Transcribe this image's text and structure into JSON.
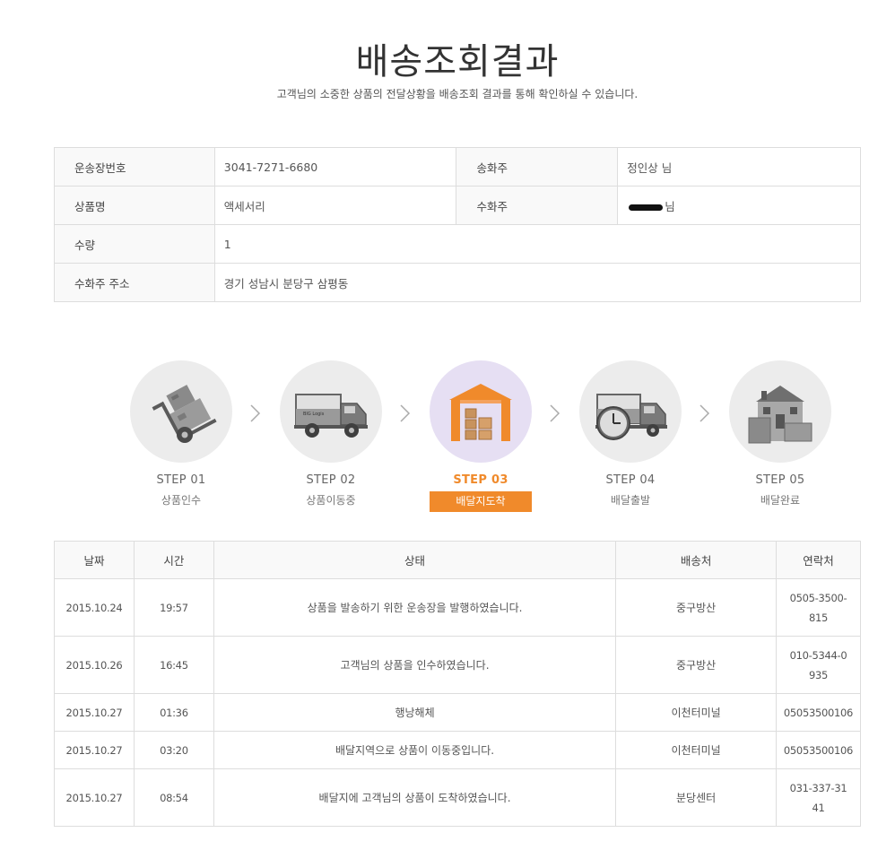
{
  "header": {
    "title": "배송조회결과",
    "subtitle": "고객님의 소중한 상품의 전달상황을 배송조회 결과를 통해 확인하실 수 있습니다."
  },
  "info": {
    "waybill_label": "운송장번호",
    "waybill_value": "3041-7271-6680",
    "sender_label": "송화주",
    "sender_value": "정인상 님",
    "product_label": "상품명",
    "product_value": "액세서리",
    "receiver_label": "수화주",
    "receiver_suffix": "님",
    "qty_label": "수량",
    "qty_value": "1",
    "address_label": "수화주 주소",
    "address_value": "경기 성남시 분당구 삼평동"
  },
  "steps": [
    {
      "num": "STEP 01",
      "label": "상품인수",
      "icon": "hand-truck-icon"
    },
    {
      "num": "STEP 02",
      "label": "상품이동중",
      "icon": "delivery-truck-icon"
    },
    {
      "num": "STEP 03",
      "label": "배달지도착",
      "icon": "warehouse-icon",
      "active": true
    },
    {
      "num": "STEP 04",
      "label": "배달출발",
      "icon": "clock-truck-icon"
    },
    {
      "num": "STEP 05",
      "label": "배달완료",
      "icon": "house-icon"
    }
  ],
  "truck_logo": "BIG Logis",
  "colors": {
    "accent": "#f08a2b",
    "active_circle": "#e6dff3",
    "circle": "#ececec"
  },
  "history": {
    "headers": [
      "날짜",
      "시간",
      "상태",
      "배송처",
      "연락처"
    ],
    "rows": [
      {
        "date": "2015.10.24",
        "time": "19:57",
        "status": "상품을 발송하기 위한 운송장을 발행하였습니다.",
        "place": "중구방산",
        "contact": "0505-3500-815"
      },
      {
        "date": "2015.10.26",
        "time": "16:45",
        "status": "고객님의 상품을 인수하였습니다.",
        "place": "중구방산",
        "contact": "010-5344-0935"
      },
      {
        "date": "2015.10.27",
        "time": "01:36",
        "status": "행낭해체",
        "place": "이천터미널",
        "contact": "05053500106"
      },
      {
        "date": "2015.10.27",
        "time": "03:20",
        "status": "배달지역으로 상품이 이동중입니다.",
        "place": "이천터미널",
        "contact": "05053500106"
      },
      {
        "date": "2015.10.27",
        "time": "08:54",
        "status": "배달지에 고객님의 상품이 도착하였습니다.",
        "place": "분당센터",
        "contact": "031-337-3141"
      }
    ]
  }
}
